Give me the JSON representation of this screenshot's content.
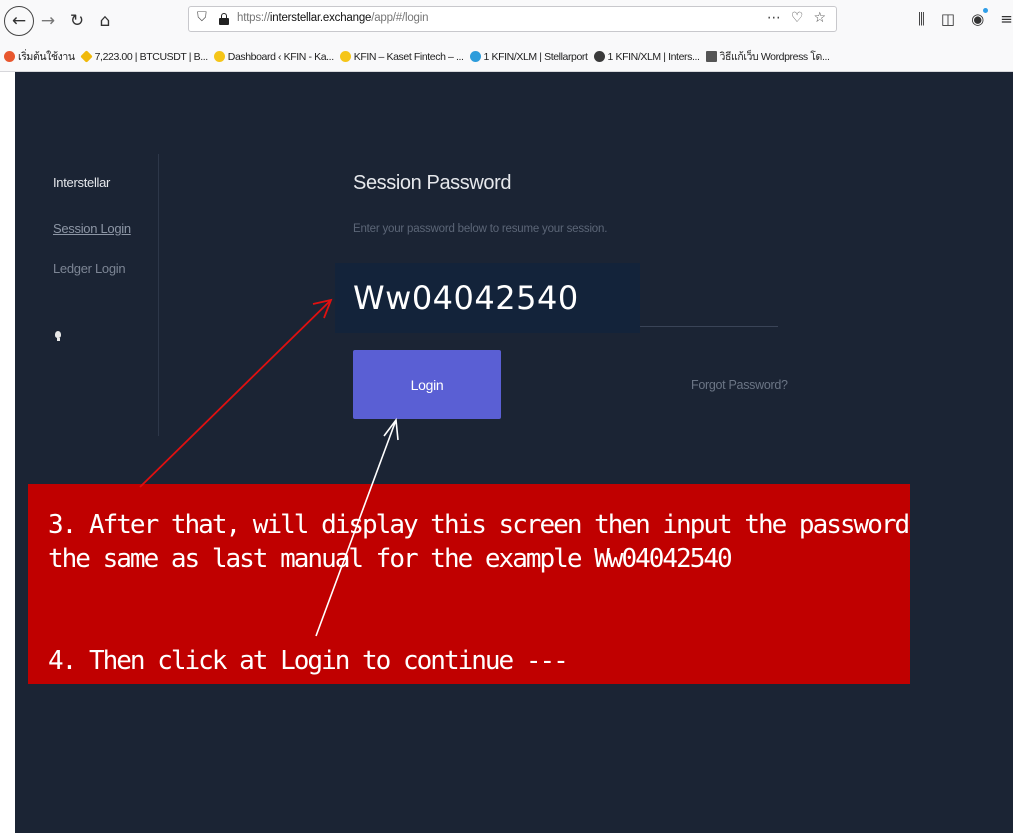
{
  "browser": {
    "url_prefix": "https://",
    "url_host": "interstellar.exchange",
    "url_path": "/app/#/login",
    "bookmarks": [
      {
        "label": "เริ่มต้นใช้งาน",
        "color": "#e8572e"
      },
      {
        "label": "7,223.00 | BTCUSDT | B...",
        "color": "#f0b90b"
      },
      {
        "label": "Dashboard ‹ KFIN - Ka...",
        "color": "#f5c518"
      },
      {
        "label": "KFIN – Kaset Fintech – ...",
        "color": "#f5c518"
      },
      {
        "label": "1 KFIN/XLM | Stellarport",
        "color": "#2d9cdb"
      },
      {
        "label": "1 KFIN/XLM | Inters...",
        "color": "#3a3a3a"
      },
      {
        "label": "วิธีแก้เว็บ Wordpress โด...",
        "color": "#555555"
      }
    ]
  },
  "sidebar": {
    "title": "Interstellar",
    "items": [
      {
        "label": "Session Login"
      },
      {
        "label": "Ledger Login"
      }
    ]
  },
  "form": {
    "title": "Session Password",
    "subtitle": "Enter your password below to resume your session.",
    "password_value": "Ww04042540",
    "login_label": "Login",
    "forgot_label": "Forgot Password?"
  },
  "annotation": {
    "line1": "3. After that, will display this screen then input the password",
    "line2": "the same as last manual for the example Ww04042540",
    "line3": "4. Then click at  Login  to  continue ---",
    "color": "#c00000"
  }
}
